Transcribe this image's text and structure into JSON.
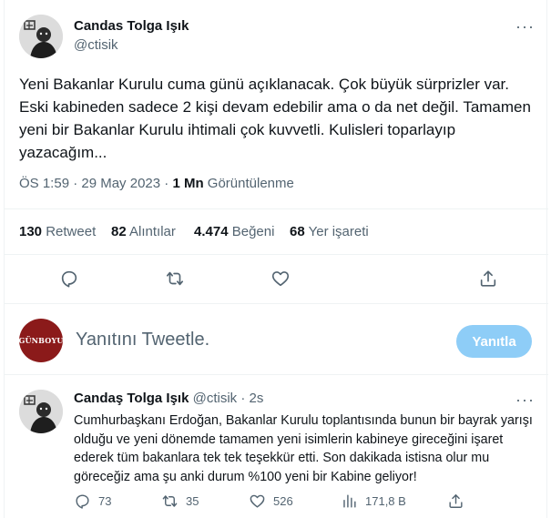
{
  "main_tweet": {
    "author_name": "Candas Tolga Işık",
    "author_handle": "@ctisik",
    "text": "Yeni Bakanlar Kurulu cuma günü açıklanacak. Çok büyük sürprizler var. Eski kabineden sadece 2 kişi devam edebilir ama o da net değil. Tamamen yeni bir Bakanlar Kurulu ihtimali çok kuvvetli. Kulisleri toparlayıp yazacağım...",
    "time": "ÖS 1:59 · 29 May 2023 ·",
    "views_count": "1 Mn",
    "views_label": "Görüntülenme",
    "stats": {
      "retweets_count": "130",
      "retweets_label": "Retweet",
      "quotes_count": "82",
      "quotes_label": "Alıntılar",
      "likes_count": "4.474",
      "likes_label": "Beğeni",
      "bookmarks_count": "68",
      "bookmarks_label": "Yer işareti"
    }
  },
  "composer": {
    "avatar_text": "GÜNBOYU",
    "placeholder": "Yanıtını Tweetle.",
    "reply_button": "Yanıtla"
  },
  "reply_tweet": {
    "author_name": "Candaş Tolga Işık",
    "author_handle": "@ctisik",
    "separator": "·",
    "time": "2s",
    "text": "Cumhurbaşkanı Erdoğan, Bakanlar Kurulu toplantısında bunun bir bayrak yarışı olduğu ve yeni dönemde tamamen yeni isimlerin kabineye gireceğini işaret ederek tüm bakanlara tek tek teşekkür etti. Son dakikada istisna olur mu göreceğiz ama şu anki durum %100 yeni bir Kabine geliyor!",
    "replies": "73",
    "retweets": "35",
    "likes": "526",
    "views": "171,8 B"
  },
  "icons": [
    "more-icon",
    "reply-icon",
    "retweet-icon",
    "like-icon",
    "share-icon",
    "views-icon"
  ],
  "colors": {
    "text": "#0f1419",
    "muted": "#536471",
    "reply_button": "#8ecdf7",
    "avatar_brand": "#8b1a1a",
    "divider": "#eff3f4"
  }
}
